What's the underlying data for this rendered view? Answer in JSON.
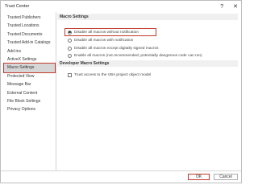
{
  "window": {
    "title": "Trust Center",
    "help_glyph": "?",
    "close_glyph": "✕"
  },
  "sidebar": {
    "items": [
      {
        "label": "Trusted Publishers"
      },
      {
        "label": "Trusted Locations"
      },
      {
        "label": "Trusted Documents"
      },
      {
        "label": "Trusted Add-in Catalogs"
      },
      {
        "label": "Add-ins"
      },
      {
        "label": "ActiveX Settings"
      },
      {
        "label": "Macro Settings",
        "selected": true
      },
      {
        "label": "Protected View"
      },
      {
        "label": "Message Bar"
      },
      {
        "label": "External Content"
      },
      {
        "label": "File Block Settings"
      },
      {
        "label": "Privacy Options"
      }
    ]
  },
  "macro_settings": {
    "header": "Macro Settings",
    "options": [
      {
        "label": "Disable all macros without notification",
        "selected": true
      },
      {
        "label": "Disable all macros with notification",
        "selected": false
      },
      {
        "label": "Disable all macros except digitally signed macros",
        "selected": false
      },
      {
        "label": "Enable all macros (not recommended; potentially dangerous code can run)",
        "selected": false
      }
    ]
  },
  "developer_settings": {
    "header": "Developer Macro Settings",
    "checkbox_label": "Trust access to the VBA project object model",
    "checked": false
  },
  "footer": {
    "ok_label": "OK",
    "cancel_label": "Cancel"
  }
}
